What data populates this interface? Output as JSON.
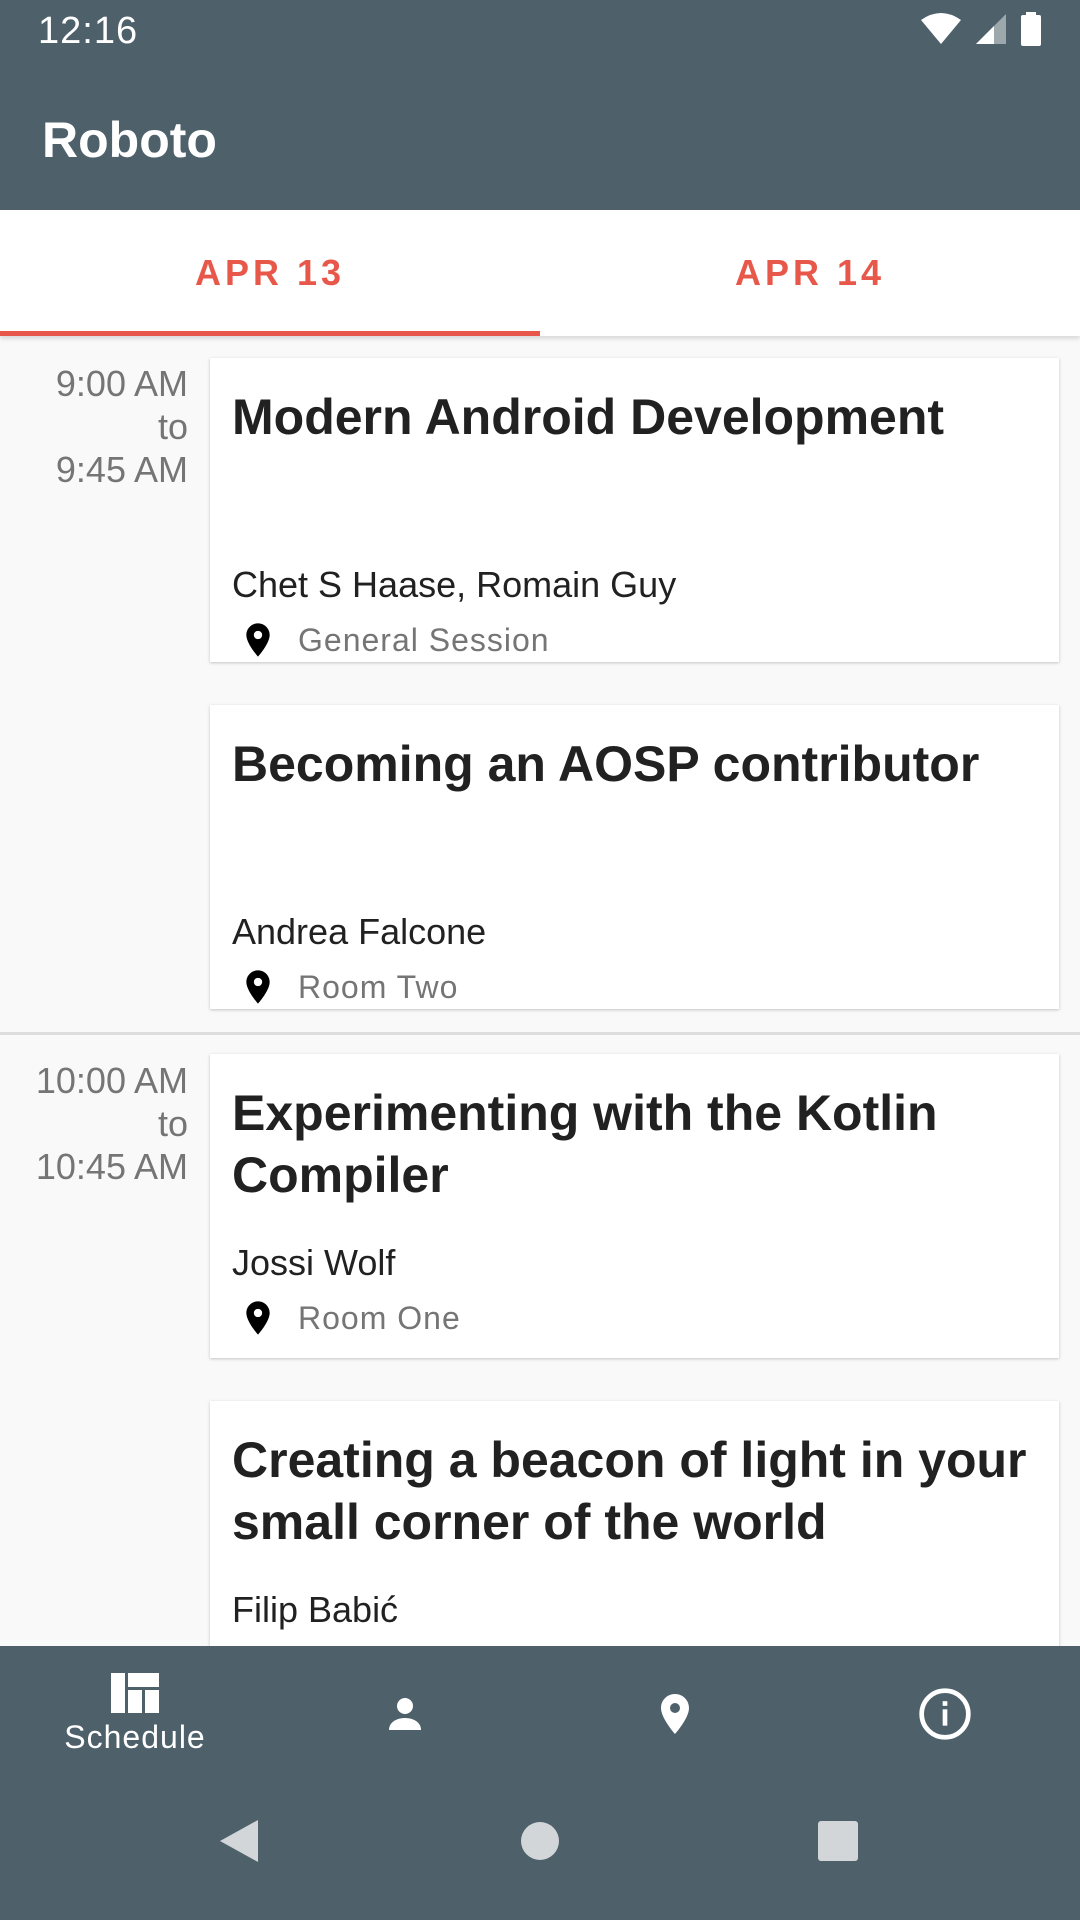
{
  "status": {
    "time": "12:16"
  },
  "app": {
    "title": "Roboto"
  },
  "tabs": [
    {
      "label": "APR 13",
      "selected": true
    },
    {
      "label": "APR 14",
      "selected": false
    }
  ],
  "slots": [
    {
      "start": "9:00 AM",
      "to": "to",
      "end": "9:45 AM",
      "sessions": [
        {
          "title": "Modern Android Development",
          "speakers": "Chet S Haase, Romain Guy",
          "room": "General Session"
        },
        {
          "title": "Becoming an AOSP contributor",
          "speakers": "Andrea Falcone",
          "room": "Room Two"
        }
      ]
    },
    {
      "start": "10:00 AM",
      "to": "to",
      "end": "10:45 AM",
      "sessions": [
        {
          "title": "Experimenting with the Kotlin Compiler",
          "speakers": "Jossi Wolf",
          "room": "Room One"
        },
        {
          "title": "Creating a beacon of light in your small corner of the world",
          "speakers": "Filip Babić",
          "room": ""
        }
      ]
    }
  ],
  "bottom_nav": [
    {
      "label": "Schedule",
      "icon": "schedule-icon",
      "selected": true
    },
    {
      "label": "",
      "icon": "person-icon"
    },
    {
      "label": "",
      "icon": "location-icon"
    },
    {
      "label": "",
      "icon": "info-icon"
    }
  ],
  "colors": {
    "primary": "#4e616b",
    "accent": "#e8584a"
  }
}
